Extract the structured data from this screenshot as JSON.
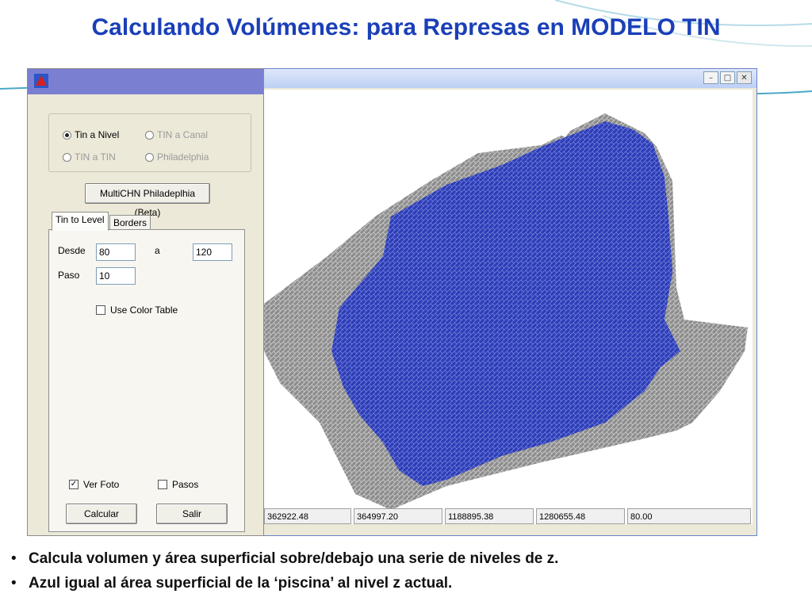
{
  "slide": {
    "title": "Calculando Volúmenes: para Represas en MODELO TIN",
    "bullets": [
      "Calcula volumen y área superficial sobre/debajo una serie de niveles de z.",
      "Azul igual al área superficial de la ‘piscina’ al nivel z actual."
    ]
  },
  "colors": {
    "title": "#1a3fb8",
    "pool_blue": "#2f3fb8",
    "terrain_gray": "#9a9a9a",
    "panel_titlebar": "#7b7fd2"
  },
  "panel": {
    "radios": [
      {
        "label": "Tin a Nivel",
        "checked": true,
        "enabled": true
      },
      {
        "label": "TIN a Canal",
        "checked": false,
        "enabled": false
      },
      {
        "label": "TIN a TIN",
        "checked": false,
        "enabled": false
      },
      {
        "label": "Philadelphia",
        "checked": false,
        "enabled": false
      }
    ],
    "multichn_button": "MultiCHN Philadeplhia (Beta)",
    "tabs": [
      {
        "label": "Tin to Level",
        "active": true
      },
      {
        "label": "Borders",
        "active": false
      }
    ],
    "desde_label": "Desde",
    "desde_value": "80",
    "a_label": "a",
    "a_value": "120",
    "paso_label": "Paso",
    "paso_value": "10",
    "use_color_table": "Use Color Table",
    "ver_foto": "Ver Foto",
    "ver_foto_checked": true,
    "pasos": "Pasos",
    "pasos_checked": false,
    "calcular": "Calcular",
    "salir": "Salir"
  },
  "viewer": {
    "window_buttons": [
      "minimize-icon",
      "maximize-icon",
      "close-icon"
    ],
    "status": [
      "362922.48",
      "364997.20",
      "1188895.38",
      "1280655.48",
      "80.00"
    ]
  }
}
